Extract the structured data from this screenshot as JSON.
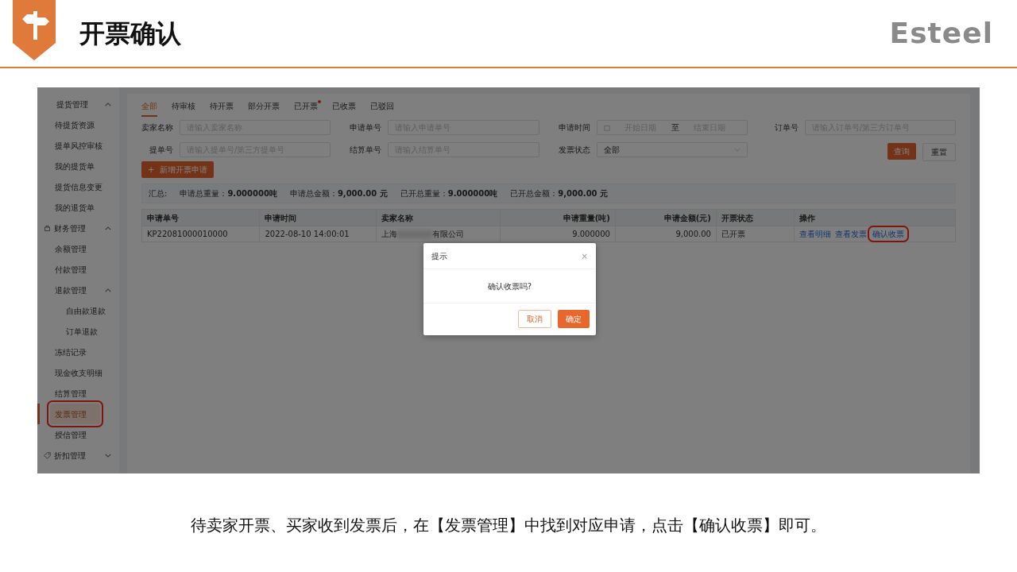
{
  "slide": {
    "title": "开票确认",
    "logo": "Esteel",
    "caption": "待卖家开票、买家收到发票后，在【发票管理】中找到对应申请，点击【确认收票】即可。"
  },
  "sidebar": [
    {
      "label": "提货管理",
      "has_icon": false,
      "expanded": true,
      "selected": false,
      "children": [
        {
          "label": "待提货资源",
          "selected": false
        },
        {
          "label": "提单风控审核",
          "selected": false
        },
        {
          "label": "我的提货单",
          "selected": false
        },
        {
          "label": "提货信息变更",
          "selected": false
        },
        {
          "label": "我的退货单",
          "selected": false
        }
      ]
    },
    {
      "label": "财务管理",
      "has_icon": true,
      "expanded": true,
      "selected": false,
      "children": [
        {
          "label": "余额管理",
          "selected": false
        },
        {
          "label": "付款管理",
          "selected": false
        },
        {
          "label": "退款管理",
          "expanded": true,
          "selected": false,
          "children": [
            {
              "label": "自由款退款",
              "selected": false
            },
            {
              "label": "订单退款",
              "selected": false
            }
          ]
        },
        {
          "label": "冻结记录",
          "selected": false
        },
        {
          "label": "现金收支明细",
          "selected": false
        },
        {
          "label": "结算管理",
          "selected": false
        },
        {
          "label": "发票管理",
          "selected": true,
          "highlighted": true
        },
        {
          "label": "授信管理",
          "selected": false
        }
      ]
    },
    {
      "label": "折扣管理",
      "has_icon": true,
      "expanded": false,
      "selected": false
    }
  ],
  "tabs": [
    {
      "label": "全部",
      "selected": true,
      "dot": false
    },
    {
      "label": "待审核",
      "selected": false,
      "dot": false
    },
    {
      "label": "待开票",
      "selected": false,
      "dot": false
    },
    {
      "label": "部分开票",
      "selected": false,
      "dot": false
    },
    {
      "label": "已开票",
      "selected": false,
      "dot": true
    },
    {
      "label": "已收票",
      "selected": false,
      "dot": false
    },
    {
      "label": "已驳回",
      "selected": false,
      "dot": false
    }
  ],
  "filters": [
    {
      "kind": "text",
      "label": "卖家名称",
      "placeholder": "请输入卖家名称"
    },
    {
      "kind": "text",
      "label": "申请单号",
      "placeholder": "请输入申请单号"
    },
    {
      "kind": "daterange",
      "label": "申请时间",
      "start_placeholder": "开始日期",
      "separator": "至",
      "end_placeholder": "结束日期"
    },
    {
      "kind": "text",
      "label": "订单号",
      "placeholder": "请输入订单号/第三方订单号"
    },
    {
      "kind": "text",
      "label": "提单号",
      "placeholder": "请输入提单号/第三方提单号"
    },
    {
      "kind": "text",
      "label": "结算单号",
      "placeholder": "请输入结算单号"
    },
    {
      "kind": "select",
      "label": "发票状态",
      "value": "全部"
    }
  ],
  "filter_buttons": [
    {
      "label": "查询",
      "kind": "primary"
    },
    {
      "label": "重置",
      "kind": "default"
    }
  ],
  "new_button": {
    "icon": "+",
    "label": "新增开票申请"
  },
  "summary": {
    "label": "汇总:",
    "items": [
      "申请总重量：**9.000000吨**",
      "申请总金额：**9,000.00 元**",
      "已开总重量：**9.000000吨**",
      "已开总金额：**9,000.00 元**"
    ]
  },
  "table": {
    "columns": [
      {
        "label": "申请单号"
      },
      {
        "label": "申请时间"
      },
      {
        "label": "卖家名称"
      },
      {
        "label": "申请重量(吨)"
      },
      {
        "label": "申请金额(元)"
      },
      {
        "label": "开票状态"
      },
      {
        "label": "操作"
      }
    ],
    "rows": [
      {
        "cells": [
          "KP22081000010000",
          "2022-08-10 14:00:01",
          {
            "before": "上海",
            "after": "有限公司"
          },
          "9.000000",
          "9,000.00",
          "已开票"
        ],
        "actions": [
          {
            "label": "查看明细",
            "highlighted": false
          },
          {
            "label": "查看发票",
            "highlighted": false
          },
          {
            "label": "确认收票",
            "highlighted": true
          }
        ]
      }
    ]
  },
  "dialog": {
    "title": "提示",
    "close": "×",
    "message": "确认收票吗?",
    "buttons": [
      {
        "label": "取消",
        "kind": "default"
      },
      {
        "label": "确定",
        "kind": "primary"
      }
    ]
  }
}
